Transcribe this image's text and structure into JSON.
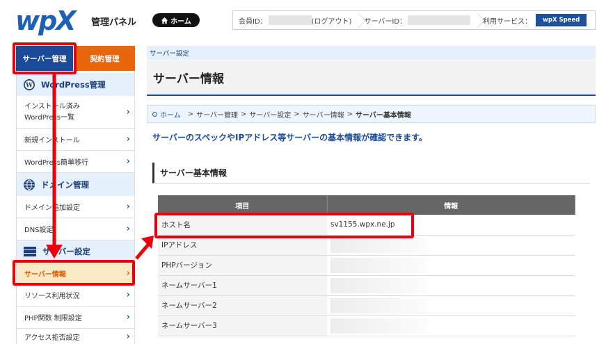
{
  "header": {
    "logo_text": "wpX",
    "panel_title": "管理パネル",
    "home_button": "ホーム",
    "member_label": "会員ID：",
    "logout_label": "(ログアウト)",
    "server_label": "サーバーID：",
    "service_label": "利用サービス：",
    "service_button": "wpX Speed"
  },
  "sidebar": {
    "tab_server": "サーバー管理",
    "tab_contract": "契約管理",
    "sections": [
      {
        "title": "WordPress管理",
        "icon": "wordpress-icon"
      },
      {
        "title": "ドメイン管理",
        "icon": "globe-icon"
      },
      {
        "title": "サーバー設定",
        "icon": "server-icon"
      }
    ],
    "items": [
      {
        "label_line1": "インストール済み",
        "label_line2": "WordPress一覧"
      },
      {
        "label": "新規インストール"
      },
      {
        "label": "WordPress簡単移行"
      },
      {
        "label": "ドメイン追加設定"
      },
      {
        "label": "DNS設定"
      },
      {
        "label": "サーバー情報"
      },
      {
        "label": "リソース利用状況"
      },
      {
        "label": "PHP関数 制限設定"
      },
      {
        "label": "アクセス拒否設定"
      }
    ]
  },
  "main": {
    "crumb_bar": "サーバー設定",
    "page_title": "サーバー情報",
    "breadcrumb": {
      "home": "ホーム",
      "sep": ">",
      "items": [
        "サーバー管理",
        "サーバー設定",
        "サーバー情報"
      ],
      "current": "サーバー基本情報"
    },
    "lead": "サーバーのスペックやIPアドレス等サーバーの基本情報が確認できます。",
    "section_title": "サーバー基本情報",
    "table": {
      "headers": [
        "項目",
        "情報"
      ],
      "rows": [
        {
          "key": "ホスト名",
          "value": "sv1155.wpx.ne.jp"
        },
        {
          "key": "IPアドレス",
          "value": ""
        },
        {
          "key": "PHPバージョン",
          "value": ""
        },
        {
          "key": "ネームサーバー1",
          "value": ""
        },
        {
          "key": "ネームサーバー2",
          "value": ""
        },
        {
          "key": "ネームサーバー3",
          "value": ""
        }
      ]
    }
  },
  "colors": {
    "brand_blue": "#1b4a99",
    "contract_orange": "#e9650c",
    "annotation_red": "#e8000b",
    "active_item_bg": "#fbe9c6"
  }
}
